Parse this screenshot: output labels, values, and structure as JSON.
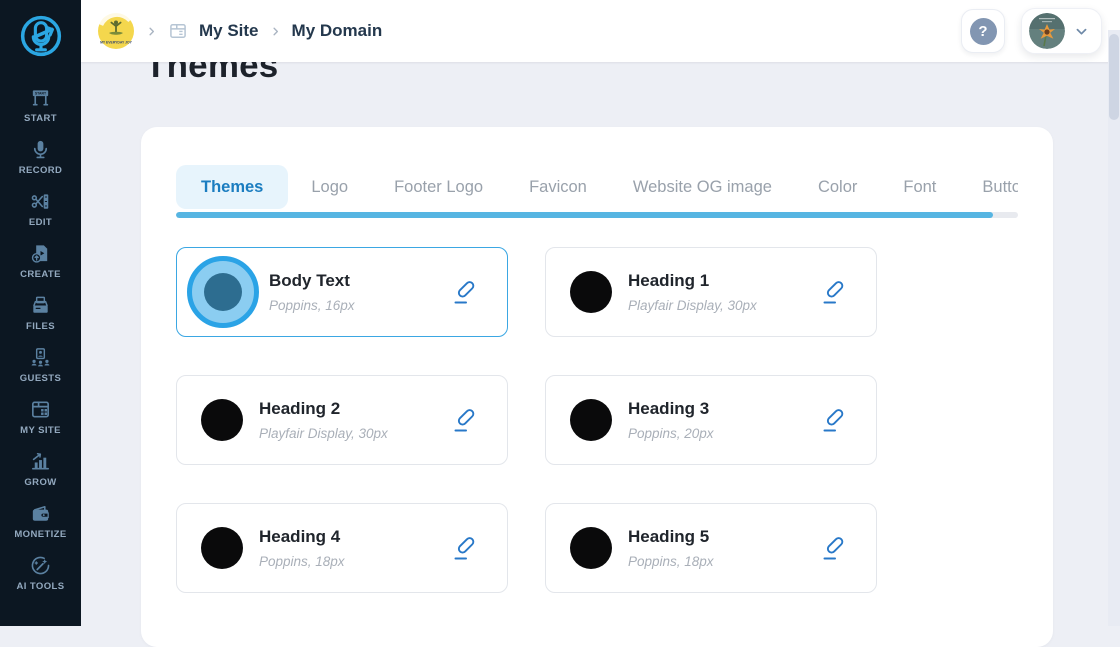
{
  "sidebar": {
    "items": [
      {
        "label": "START",
        "icon": "start-icon",
        "icon_text": "START"
      },
      {
        "label": "RECORD",
        "icon": "record-icon"
      },
      {
        "label": "EDIT",
        "icon": "edit-icon"
      },
      {
        "label": "CREATE",
        "icon": "create-icon"
      },
      {
        "label": "FILES",
        "icon": "files-icon"
      },
      {
        "label": "GUESTS",
        "icon": "guests-icon"
      },
      {
        "label": "MY SITE",
        "icon": "my-site-icon"
      },
      {
        "label": "GROW",
        "icon": "grow-icon"
      },
      {
        "label": "MONETIZE",
        "icon": "monetize-icon"
      },
      {
        "label": "AI TOOLS",
        "icon": "ai-tools-icon"
      }
    ]
  },
  "header": {
    "site_logo_text": "MY EVERYDAY JOY",
    "breadcrumb": {
      "site": "My Site",
      "page": "My Domain"
    },
    "help_label": "?"
  },
  "page": {
    "title": "Themes"
  },
  "tabs": [
    {
      "label": "Themes",
      "active": true
    },
    {
      "label": "Logo"
    },
    {
      "label": "Footer Logo"
    },
    {
      "label": "Favicon"
    },
    {
      "label": "Website OG image"
    },
    {
      "label": "Color"
    },
    {
      "label": "Font"
    },
    {
      "label": "Button"
    }
  ],
  "cards": [
    {
      "title": "Body Text",
      "font": "Poppins, 16px",
      "selected": true
    },
    {
      "title": "Heading 1",
      "font": "Playfair Display, 30px"
    },
    {
      "title": "Heading 2",
      "font": "Playfair Display, 30px"
    },
    {
      "title": "Heading 3",
      "font": "Poppins, 20px"
    },
    {
      "title": "Heading 4",
      "font": "Poppins, 18px"
    },
    {
      "title": "Heading 5",
      "font": "Poppins, 18px"
    }
  ],
  "colors": {
    "sidebar_bg": "#0c1722",
    "accent_blue": "#2aa3e6",
    "active_tab_text": "#1b7dc0",
    "active_tab_bg": "#e7f4fc",
    "tab_underline": "#56b5e2",
    "selected_card_border": "#3ba7e3",
    "swatch_black": "#0a0a0b",
    "swatch_selected_core": "#2d6d90",
    "page_bg": "#edeff5",
    "edit_icon": "#2878c8"
  }
}
